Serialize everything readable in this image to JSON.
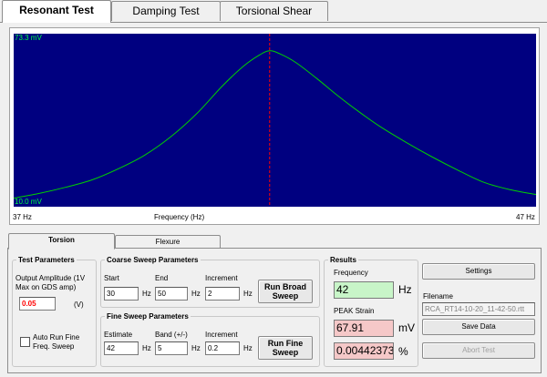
{
  "tabs": [
    "Resonant Test",
    "Damping Test",
    "Torsional Shear"
  ],
  "graph": {
    "y_max_label": "73.3 mV",
    "y_min_label": "10.0 mV",
    "x_min_label": "37 Hz",
    "x_label": "Frequency (Hz)",
    "x_max_label": "47 Hz"
  },
  "chart_data": {
    "type": "line",
    "xlabel": "Frequency (Hz)",
    "xlim": [
      37,
      47
    ],
    "ylim": [
      10.0,
      73.3
    ],
    "peak_marker_x": 41.9,
    "series": [
      {
        "color": "#00d000",
        "x": [
          37.0,
          37.5,
          38.0,
          38.5,
          39.0,
          39.5,
          40.0,
          40.5,
          41.0,
          41.4,
          41.7,
          41.9,
          42.1,
          42.4,
          42.8,
          43.2,
          43.6,
          44.0,
          44.5,
          45.0,
          45.5,
          46.0,
          46.5,
          47.0
        ],
        "y": [
          10.5,
          12.5,
          15.0,
          18.0,
          22.5,
          28.0,
          35.5,
          45.0,
          56.5,
          64.5,
          69.0,
          70.8,
          69.5,
          66.0,
          59.5,
          52.5,
          46.0,
          40.0,
          33.5,
          27.5,
          22.0,
          17.0,
          14.0,
          12.0
        ]
      }
    ]
  },
  "bottom_tabs": [
    "Torsion",
    "Flexure"
  ],
  "test_params": {
    "legend": "Test Parameters",
    "amplitude_label": "Output Amplitude (1V Max on GDS amp)",
    "amplitude_value": "0.05",
    "amplitude_unit": "(V)",
    "auto_run_label": "Auto Run Fine Freq. Sweep"
  },
  "coarse": {
    "legend": "Coarse Sweep Parameters",
    "start_label": "Start",
    "start_value": "30",
    "start_unit": "Hz",
    "end_label": "End",
    "end_value": "50",
    "end_unit": "Hz",
    "increment_label": "Increment",
    "increment_value": "2",
    "increment_unit": "Hz",
    "button": "Run Broad Sweep"
  },
  "fine": {
    "legend": "Fine Sweep Parameters",
    "estimate_label": "Estimate",
    "estimate_value": "42",
    "estimate_unit": "Hz",
    "band_label": "Band (+/-)",
    "band_value": "5",
    "band_unit": "Hz",
    "increment_label": "Increment",
    "increment_value": "0.2",
    "increment_unit": "Hz",
    "button": "Run Fine Sweep"
  },
  "results": {
    "legend": "Results",
    "frequency_label": "Frequency",
    "frequency_value": "42",
    "frequency_unit": "Hz",
    "peak_label": "PEAK Strain",
    "peak_mv_value": "67.91",
    "peak_mv_unit": "mV",
    "peak_pct_value": "0.00442373",
    "peak_pct_unit": "%"
  },
  "actions": {
    "settings": "Settings",
    "filename_label": "Filename",
    "filename_value": "RCA_RT14-10-20_11-42-50.rtt",
    "save": "Save Data",
    "abort": "Abort Test"
  },
  "colors": {
    "plot_bg": "#000080",
    "curve": "#00d000",
    "marker": "#ff0000",
    "amplitude_text": "#ff0000",
    "freq_field_bg": "#c8f5c8",
    "strain_field_bg": "#f5c8c8"
  }
}
